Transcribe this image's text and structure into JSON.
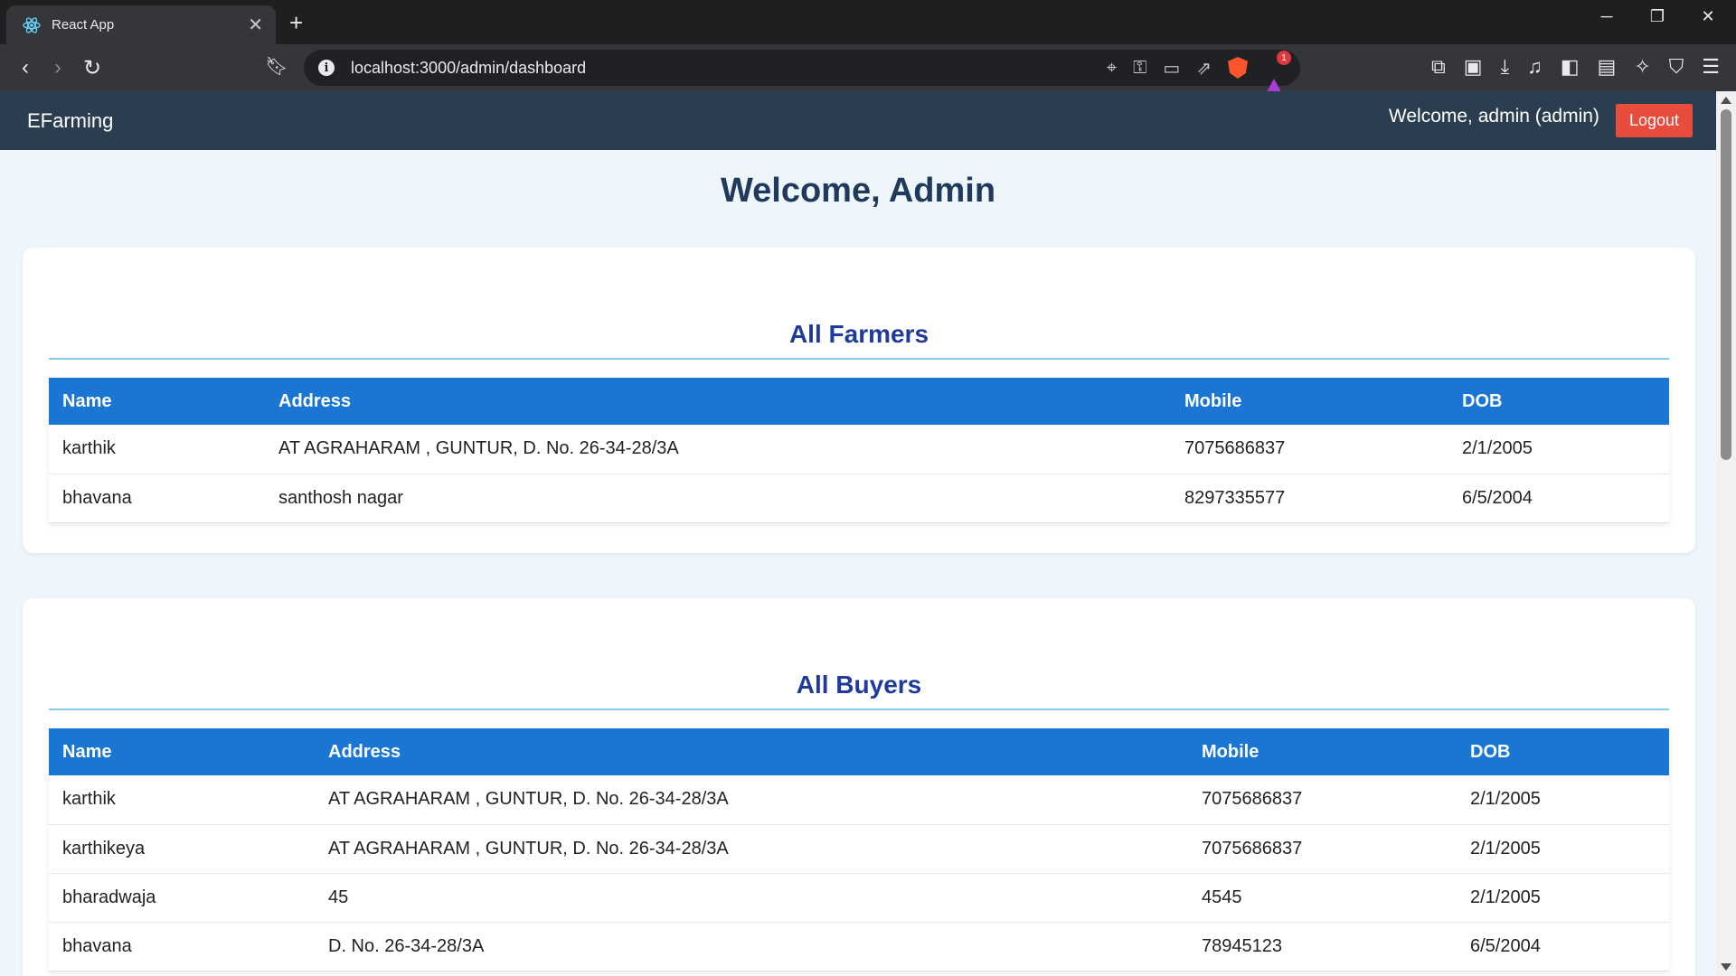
{
  "browser": {
    "tab_title": "React App",
    "url": "localhost:3000/admin/dashboard",
    "rewards_badge": "1"
  },
  "navbar": {
    "brand": "EFarming",
    "welcome_text": "Welcome, admin (admin)",
    "logout_label": "Logout"
  },
  "page_title": "Welcome, Admin",
  "farmers": {
    "title": "All Farmers",
    "headers": [
      "Name",
      "Address",
      "Mobile",
      "DOB"
    ],
    "rows": [
      [
        "karthik",
        "AT AGRAHARAM , GUNTUR, D. No. 26-34-28/3A",
        "7075686837",
        "2/1/2005"
      ],
      [
        "bhavana",
        "santhosh nagar",
        "8297335577",
        "6/5/2004"
      ]
    ]
  },
  "buyers": {
    "title": "All Buyers",
    "headers": [
      "Name",
      "Address",
      "Mobile",
      "DOB"
    ],
    "rows": [
      [
        "karthik",
        "AT AGRAHARAM , GUNTUR, D. No. 26-34-28/3A",
        "7075686837",
        "2/1/2005"
      ],
      [
        "karthikeya",
        "AT AGRAHARAM , GUNTUR, D. No. 26-34-28/3A",
        "7075686837",
        "2/1/2005"
      ],
      [
        "bharadwaja",
        "45",
        "4545",
        "2/1/2005"
      ],
      [
        "bhavana",
        "D. No. 26-34-28/3A",
        "78945123",
        "6/5/2004"
      ]
    ]
  },
  "colors": {
    "navbar_bg": "#2b3e50",
    "logout_bg": "#e74c3c",
    "table_header_bg": "#1a76d2",
    "section_title": "#1f3a9a",
    "page_bg": "#eef6fc"
  }
}
